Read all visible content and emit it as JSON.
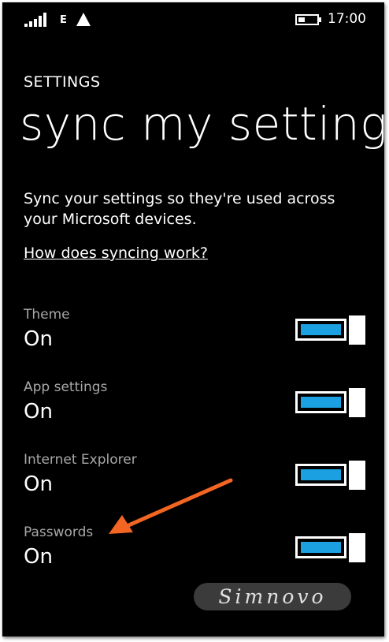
{
  "status_bar": {
    "network_type": "E",
    "time": "17:00",
    "icons": [
      "signal-icon",
      "notification-triangle-icon",
      "battery-icon"
    ]
  },
  "header": {
    "app_title": "SETTINGS",
    "page_title": "sync my settings"
  },
  "description": "Sync your settings so they're used across your Microsoft devices.",
  "help_link": "How does syncing work?",
  "settings": [
    {
      "label": "Theme",
      "value": "On",
      "enabled": true
    },
    {
      "label": "App settings",
      "value": "On",
      "enabled": true
    },
    {
      "label": "Internet Explorer",
      "value": "On",
      "enabled": true
    },
    {
      "label": "Passwords",
      "value": "On",
      "enabled": true
    }
  ],
  "watermark": "Simnovo",
  "colors": {
    "background": "#000000",
    "accent": "#1ba1e2",
    "label_gray": "#a8a8a8",
    "arrow": "#f26522"
  }
}
